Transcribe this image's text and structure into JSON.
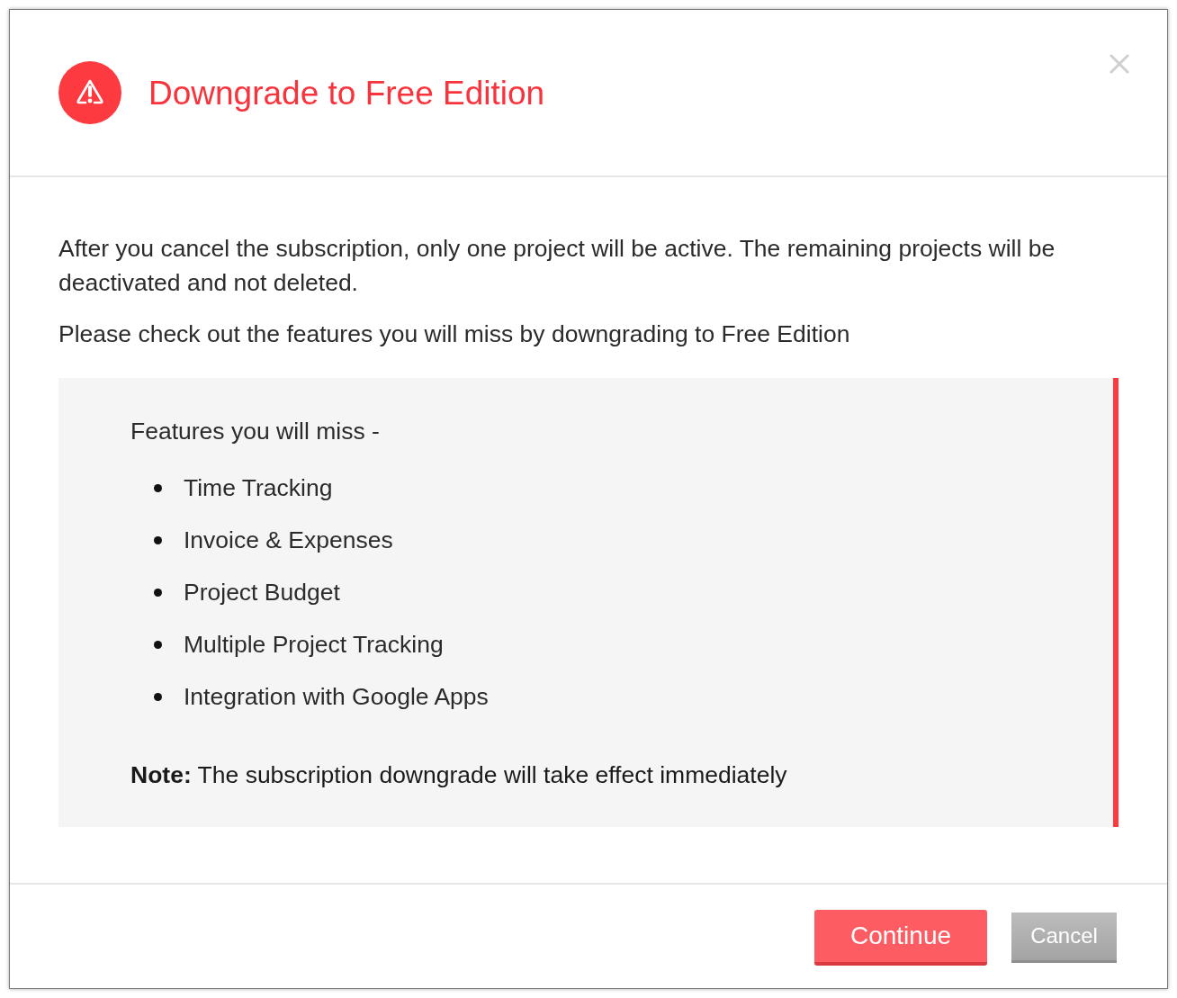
{
  "dialog": {
    "title": "Downgrade to Free Edition"
  },
  "body": {
    "paragraphs": [
      "After you cancel the subscription, only one project will be active. The remaining projects will be deactivated and not deleted.",
      "Please check out the features you will miss by downgrading to Free Edition"
    ]
  },
  "features_box": {
    "heading": "Features you will miss -",
    "items": [
      "Time Tracking",
      "Invoice & Expenses",
      "Project Budget",
      "Multiple Project Tracking",
      "Integration with Google Apps"
    ],
    "note": "**Note:** The subscription downgrade will take effect immediately"
  },
  "buttons": [
    {
      "label": "Continue",
      "kind": "primary"
    },
    {
      "label": "Cancel",
      "kind": "secondary"
    }
  ]
}
